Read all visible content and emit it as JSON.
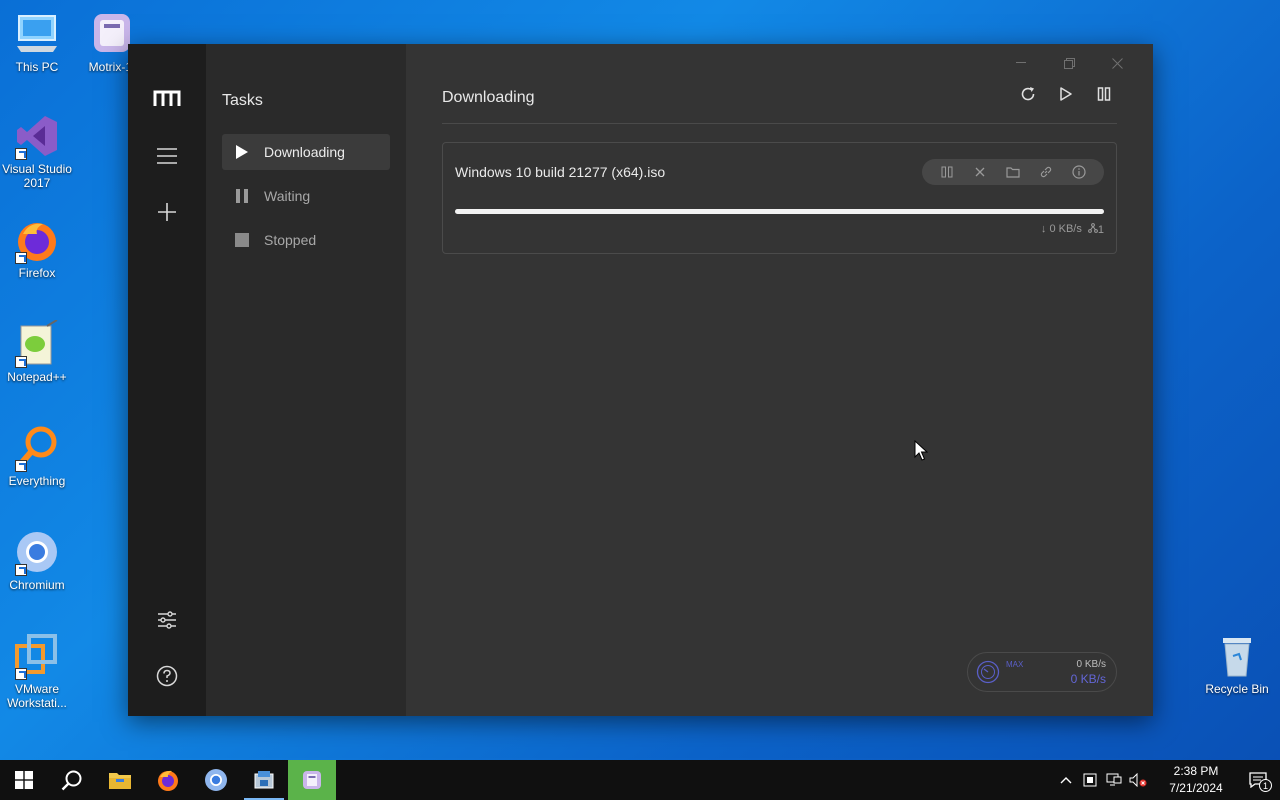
{
  "desktop": {
    "icons": [
      {
        "label": "This PC"
      },
      {
        "label": "Motrix-1."
      },
      {
        "label": "Visual Studio 2017"
      },
      {
        "label": "Firefox"
      },
      {
        "label": "Notepad++"
      },
      {
        "label": "Everything"
      },
      {
        "label": "Chromium"
      },
      {
        "label": "VMware Workstati..."
      },
      {
        "label": "Recycle Bin"
      }
    ]
  },
  "app": {
    "subnav": {
      "title": "Tasks",
      "items": [
        {
          "label": "Downloading",
          "active": true
        },
        {
          "label": "Waiting",
          "active": false
        },
        {
          "label": "Stopped",
          "active": false
        }
      ]
    },
    "main": {
      "heading": "Downloading"
    },
    "task": {
      "name": "Windows 10 build 21277 (x64).iso",
      "progress": 1.0,
      "speed": "↓ 0 KB/s",
      "connections": "1"
    },
    "speedometer": {
      "mode": "MAX",
      "upload": "0 KB/s",
      "download": "0 KB/s"
    },
    "colors": {
      "accent": "#6366d6",
      "rail_bg": "#1d1d1d",
      "window_bg": "#343434"
    }
  },
  "taskbar": {
    "time": "2:38 PM",
    "date": "7/21/2024",
    "notification_count": "1"
  }
}
